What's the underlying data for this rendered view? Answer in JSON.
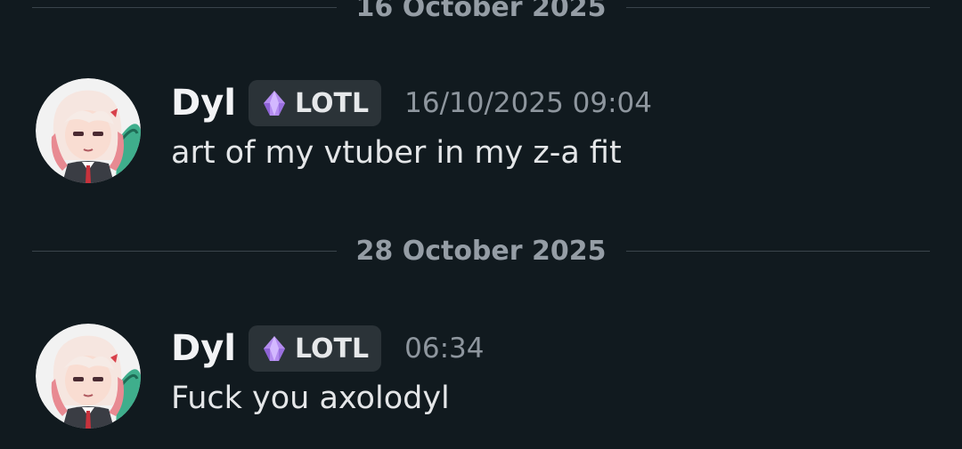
{
  "dividers": [
    {
      "label": "16 October 2025"
    },
    {
      "label": "28 October 2025"
    }
  ],
  "messages": [
    {
      "username": "Dyl",
      "role": "LOTL",
      "role_icon": "purple-gem-icon",
      "timestamp": "16/10/2025 09:04",
      "content": "art of my vtuber in my z-a fit"
    },
    {
      "username": "Dyl",
      "role": "LOTL",
      "role_icon": "purple-gem-icon",
      "timestamp": "06:34",
      "content": "Fuck you axolodyl"
    }
  ],
  "colors": {
    "background": "#111a1f",
    "role_tag_bg": "#2b3338",
    "divider_text": "#959da5",
    "timestamp": "#8e969e",
    "gem": "#b48cf0"
  }
}
